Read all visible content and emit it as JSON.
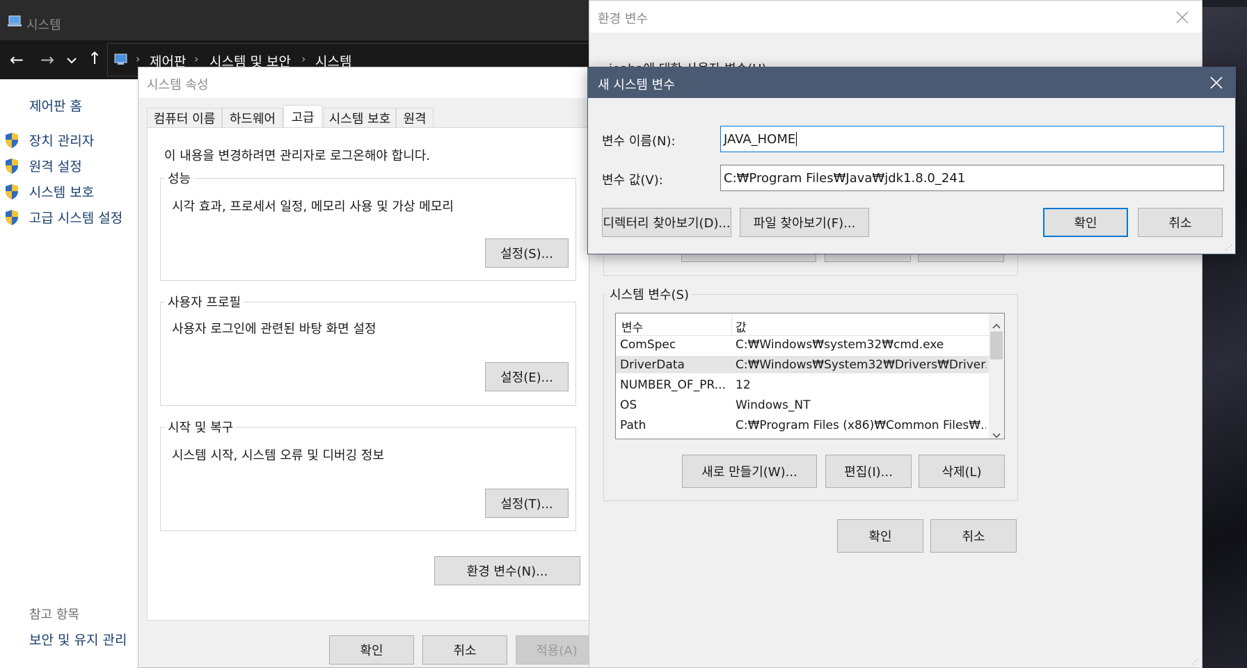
{
  "desktop": {
    "bg_color": "#1e1e26"
  },
  "system_window": {
    "title": "시스템",
    "breadcrumb": [
      "제어판",
      "시스템 및 보안",
      "시스템"
    ],
    "sidebar_home": "제어판 홈",
    "sidebar_items": [
      {
        "label": "장치 관리자",
        "icon": "shield-icon"
      },
      {
        "label": "원격 설정",
        "icon": "shield-icon"
      },
      {
        "label": "시스템 보호",
        "icon": "shield-icon"
      },
      {
        "label": "고급 시스템 설정",
        "icon": "shield-icon"
      }
    ],
    "see_also_title": "참고 항목",
    "see_also_items": [
      "보안 및 유지 관리"
    ]
  },
  "sys_props": {
    "title": "시스템 속성",
    "tabs": [
      "컴퓨터 이름",
      "하드웨어",
      "고급",
      "시스템 보호",
      "원격"
    ],
    "active_tab": "고급",
    "admin_note": "이 내용을 변경하려면 관리자로 로그온해야 합니다.",
    "groups": [
      {
        "title": "성능",
        "desc": "시각 효과, 프로세서 일정, 메모리 사용 및 가상 메모리",
        "button": "설정(S)..."
      },
      {
        "title": "사용자 프로필",
        "desc": "사용자 로그인에 관련된 바탕 화면 설정",
        "button": "설정(E)..."
      },
      {
        "title": "시작 및 복구",
        "desc": "시스템 시작, 시스템 오류 및 디버깅 정보",
        "button": "설정(T)..."
      }
    ],
    "env_button": "환경 변수(N)...",
    "ok": "확인",
    "cancel": "취소",
    "apply": "적용(A)"
  },
  "env_vars": {
    "title": "환경 변수",
    "user_section_partial": "jeaha에 대한 사용자 변수(U)",
    "system_section": "시스템 변수(S)",
    "columns": [
      "변수",
      "값"
    ],
    "rows": [
      {
        "name": "ComSpec",
        "value": "C:₩Windows₩system32₩cmd.exe"
      },
      {
        "name": "DriverData",
        "value": "C:₩Windows₩System32₩Drivers₩Driver..."
      },
      {
        "name": "NUMBER_OF_PR...",
        "value": "12"
      },
      {
        "name": "OS",
        "value": "Windows_NT"
      },
      {
        "name": "Path",
        "value": "C:₩Program Files (x86)₩Common Files₩..."
      }
    ],
    "selected_row": 1,
    "new_button": "새로 만들기(W)...",
    "edit_button": "편집(I)...",
    "delete_button": "삭제(L)",
    "ok": "확인",
    "cancel": "취소"
  },
  "new_var": {
    "title": "새 시스템 변수",
    "name_label": "변수 이름(N):",
    "name_value": "JAVA_HOME",
    "value_label": "변수 값(V):",
    "value_value": "C:₩Program Files₩Java₩jdk1.8.0_241",
    "browse_dir": "디렉터리 찾아보기(D)...",
    "browse_file": "파일 찾아보기(F)...",
    "ok": "확인",
    "cancel": "취소",
    "title_bar_color": "#4a5a72",
    "accent_color": "#0078d7"
  }
}
